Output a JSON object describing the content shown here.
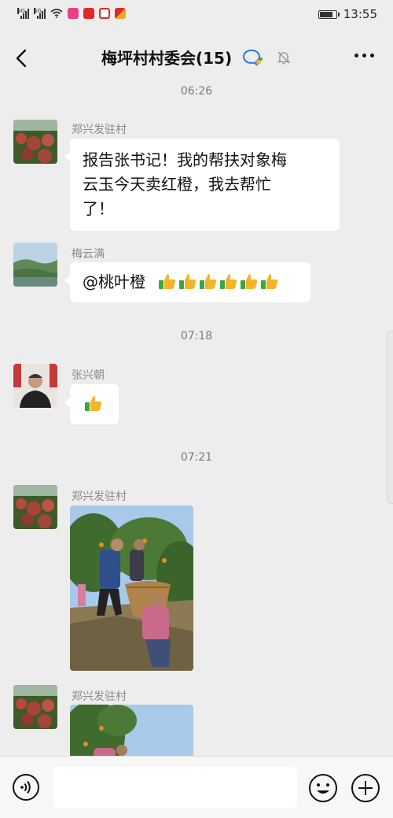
{
  "status_bar": {
    "signal_1_label": "4G",
    "signal_2_label": "4G",
    "time": "13:55",
    "battery_level": 0.85,
    "icons": [
      "signal-icon",
      "signal-icon",
      "wifi-icon",
      "app-badge-icon",
      "app-badge-icon",
      "app-badge-icon",
      "app-badge-icon",
      "battery-icon"
    ]
  },
  "header": {
    "title": "梅坪村村委会(15)",
    "icons": [
      "back-icon",
      "group-chat-icon",
      "mute-icon",
      "more-icon"
    ]
  },
  "messages": [
    {
      "type": "time",
      "text": "06:26"
    },
    {
      "type": "text",
      "sender": "郑兴发驻村",
      "avatar": "flowers-avatar",
      "lines": [
        "报告张书记！我的帮扶对象梅",
        "云玉今天卖红橙，我去帮忙",
        "了！"
      ]
    },
    {
      "type": "text",
      "sender": "梅云满",
      "avatar": "landscape-avatar",
      "text": "@桃叶橙",
      "emoji": "thumbs-up",
      "emoji_count": 6
    },
    {
      "type": "time",
      "text": "07:18"
    },
    {
      "type": "emoji",
      "sender": "张兴朝",
      "avatar": "person-avatar",
      "emoji": "thumbs-up",
      "emoji_count": 1
    },
    {
      "type": "time",
      "text": "07:21"
    },
    {
      "type": "image",
      "sender": "郑兴发驻村",
      "avatar": "flowers-avatar",
      "image": "orange-harvest-photo"
    },
    {
      "type": "image",
      "sender": "郑兴发驻村",
      "avatar": "flowers-avatar",
      "image": "orange-harvest-photo"
    }
  ],
  "input_bar": {
    "value": "",
    "icons": [
      "voice-icon",
      "emoji-icon",
      "plus-icon"
    ]
  },
  "colors": {
    "background": "#ededed",
    "bubble": "#ffffff",
    "thumb_yellow": "#f5b52a",
    "thumb_green": "#3aa83a",
    "badge_pink": "#e8418a",
    "badge_red": "#e02a2a"
  }
}
